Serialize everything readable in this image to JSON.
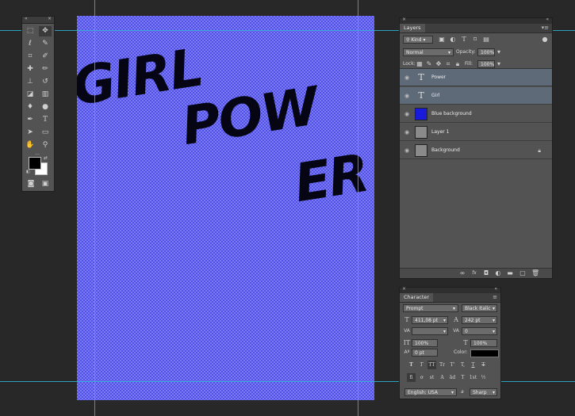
{
  "canvas": {
    "words": [
      "GIRL",
      "POW",
      "ER"
    ]
  },
  "tools_panel": {
    "collapse_icon": "double-chevron-icon",
    "close_icon": "close-icon",
    "foreground_color": "#000000",
    "background_color": "#ffffff"
  },
  "layers_panel": {
    "tab": "Layers",
    "filter": {
      "label": "Kind"
    },
    "blend_mode": "Normal",
    "opacity_label": "Opacity:",
    "opacity_value": "100%",
    "lock_label": "Lock:",
    "fill_label": "Fill:",
    "fill_value": "100%",
    "layers": [
      {
        "name": "Power",
        "kind": "text",
        "glyph": "T",
        "selected": true
      },
      {
        "name": "Girl",
        "kind": "text",
        "glyph": "T",
        "selected": true
      },
      {
        "name": "Blue background",
        "kind": "fill",
        "color": "#1a1adc",
        "selected": false
      },
      {
        "name": "Layer 1",
        "kind": "pattern",
        "selected": false
      },
      {
        "name": "Background",
        "kind": "pattern",
        "selected": false,
        "locked": true
      }
    ],
    "footer_fx": "fx"
  },
  "character_panel": {
    "tab": "Character",
    "font_family": "Prompt",
    "font_style": "Black Italic",
    "font_size": "411,08 pt",
    "leading": "242 pt",
    "kerning": "",
    "tracking": "0",
    "vertical_scale": "100%",
    "horizontal_scale": "100%",
    "baseline_shift": "0 pt",
    "color_label": "Color:",
    "color_value": "#000000",
    "style_buttons": [
      "T",
      "T",
      "TT",
      "Tr",
      "T'",
      "T,",
      "T",
      "T"
    ],
    "opentype_buttons": [
      "fi",
      "ơ",
      "st",
      "A",
      "ād",
      "T",
      "1st",
      "½"
    ],
    "language": "English: USA",
    "antialias_prefix": "a",
    "antialias": "Sharp"
  }
}
